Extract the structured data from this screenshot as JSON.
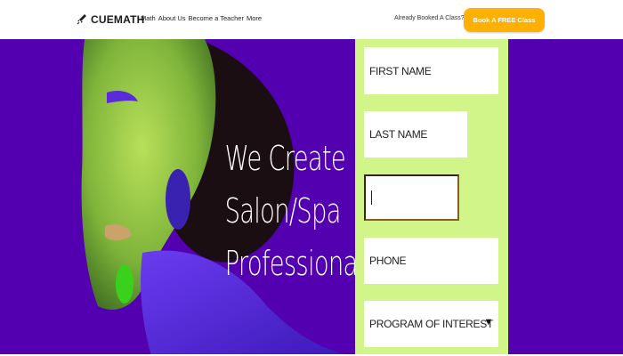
{
  "header": {
    "logo_text": "CUEMATH",
    "nav": [
      "Math",
      "About Us",
      "Become a Teacher",
      "More"
    ],
    "already_text": "Already Booked A Class?",
    "cta_label": "Book A FREE Class"
  },
  "hero": {
    "headline_lines": [
      "We Create",
      "Salon/Spa",
      "Professionals"
    ]
  },
  "form": {
    "first_name_placeholder": "FIRST NAME",
    "last_name_placeholder": "LAST NAME",
    "email_value": "",
    "phone_placeholder": "PHONE",
    "program_placeholder": "PROGRAM OF INTEREST"
  },
  "colors": {
    "accent_purple": "#5200b0",
    "form_bg": "#d2f58a",
    "cta": "#ffb000"
  }
}
